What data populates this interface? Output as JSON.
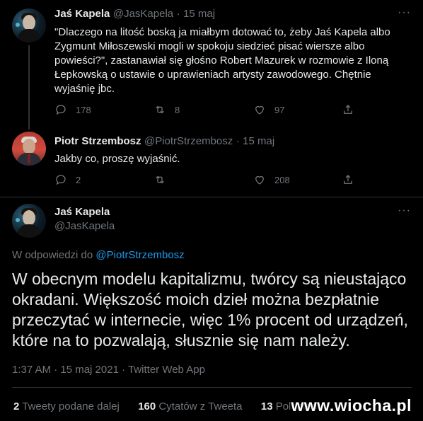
{
  "tweet1": {
    "name": "Jaś Kapela",
    "handle": "@JasKapela",
    "separator": "·",
    "date": "15 maj",
    "text": "\"Dlaczego na litość boską ja miałbym dotować to, żeby Jaś Kapela albo Zygmunt Miłoszewski mogli w spokoju siedzieć pisać wiersze albo powieści?\", zastanawiał się głośno Robert Mazurek w rozmowie z Iloną Łepkowską o ustawie o uprawieniach artysty zawodowego. Chętnie wyjaśnię jbc.",
    "more": "···",
    "replies": "178",
    "retweets": "8",
    "likes": "97"
  },
  "tweet2": {
    "name": "Piotr Strzembosz",
    "handle": "@PiotrStrzembosz",
    "separator": "·",
    "date": "15 maj",
    "text": "Jakby co, proszę wyjaśnić.",
    "replies": "2",
    "retweets": "",
    "likes": "208"
  },
  "main": {
    "name": "Jaś Kapela",
    "handle": "@JasKapela",
    "more": "···",
    "reply_prefix": "W odpowiedzi do",
    "reply_handle": "@PiotrStrzembosz",
    "text": "W obecnym modelu kapitalizmu, twórcy są nieustająco okradani. Większość moich dzieł można bezpłatnie przeczytać w internecie, więc 1% procent od urządzeń, które na to pozwalają, słusznie się nam należy.",
    "meta": "1:37 AM · 15 maj 2021 · Twitter Web App",
    "retweets_count": "2",
    "retweets_label": "Tweety podane dalej",
    "quotes_count": "160",
    "quotes_label": "Cytatów z Tweeta",
    "likes_count": "13",
    "likes_label": "Polubień"
  },
  "watermark": "www.wiocha.pl",
  "colors": {
    "background": "#000000",
    "text": "#e7e9ea",
    "muted": "#71767b",
    "link": "#1d9bf0",
    "divider": "#2f3336"
  },
  "icons": [
    "reply-icon",
    "retweet-icon",
    "like-icon",
    "share-icon",
    "more-icon"
  ]
}
